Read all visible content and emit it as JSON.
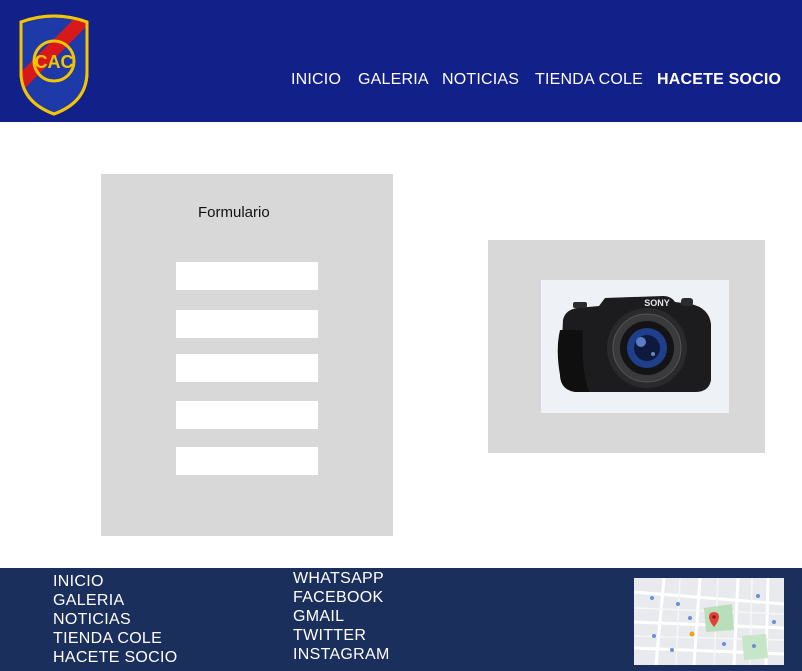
{
  "header": {
    "logo_letters": "CAC",
    "nav": [
      {
        "label": "INICIO"
      },
      {
        "label": "GALERIA"
      },
      {
        "label": "NOTICIAS"
      },
      {
        "label": "TIENDA COLE"
      },
      {
        "label": "HACETE SOCIO",
        "active": true
      }
    ],
    "colors": {
      "background": "#12208a",
      "text": "#ffffff"
    }
  },
  "form": {
    "title": "Formulario",
    "fields": [
      {
        "value": "",
        "placeholder": ""
      },
      {
        "value": "",
        "placeholder": ""
      },
      {
        "value": "",
        "placeholder": ""
      },
      {
        "value": "",
        "placeholder": ""
      },
      {
        "value": "",
        "placeholder": ""
      }
    ],
    "panel_color": "#d8d8d8"
  },
  "media": {
    "image": "camera-photo",
    "camera_brand": "SONY"
  },
  "footer": {
    "nav_links": [
      {
        "label": "INICIO"
      },
      {
        "label": "GALERIA"
      },
      {
        "label": "NOTICIAS"
      },
      {
        "label": "TIENDA COLE"
      },
      {
        "label": "HACETE SOCIO"
      }
    ],
    "social_links": [
      {
        "label": "WHATSAPP"
      },
      {
        "label": "FACEBOOK"
      },
      {
        "label": "GMAIL"
      },
      {
        "label": "TWITTER"
      },
      {
        "label": "INSTAGRAM"
      }
    ],
    "map": "location-map",
    "colors": {
      "background": "#1b2f5c"
    }
  }
}
